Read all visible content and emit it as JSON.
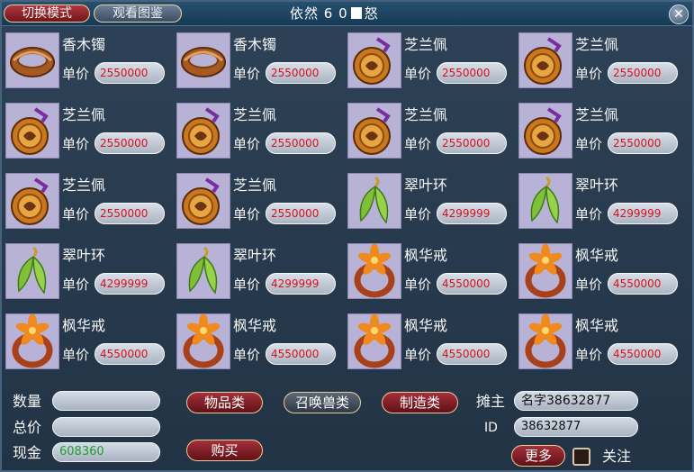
{
  "window": {
    "title": "依然 6 0",
    "title_suffix": "怒",
    "switch_mode_label": "切换模式",
    "view_atlas_label": "观看图鉴"
  },
  "price_label": "单价",
  "items": [
    {
      "name": "香木镯",
      "price": "2550000",
      "icon": "bracelet-icon"
    },
    {
      "name": "香木镯",
      "price": "2550000",
      "icon": "bracelet-icon"
    },
    {
      "name": "芝兰佩",
      "price": "2550000",
      "icon": "pendant-icon"
    },
    {
      "name": "芝兰佩",
      "price": "2550000",
      "icon": "pendant-icon"
    },
    {
      "name": "芝兰佩",
      "price": "2550000",
      "icon": "pendant-icon"
    },
    {
      "name": "芝兰佩",
      "price": "2550000",
      "icon": "pendant-icon"
    },
    {
      "name": "芝兰佩",
      "price": "2550000",
      "icon": "pendant-icon"
    },
    {
      "name": "芝兰佩",
      "price": "2550000",
      "icon": "pendant-icon"
    },
    {
      "name": "芝兰佩",
      "price": "2550000",
      "icon": "pendant-icon"
    },
    {
      "name": "芝兰佩",
      "price": "2550000",
      "icon": "pendant-icon"
    },
    {
      "name": "翠叶环",
      "price": "4299999",
      "icon": "leaf-earring-icon"
    },
    {
      "name": "翠叶环",
      "price": "4299999",
      "icon": "leaf-earring-icon"
    },
    {
      "name": "翠叶环",
      "price": "4299999",
      "icon": "leaf-earring-icon"
    },
    {
      "name": "翠叶环",
      "price": "4299999",
      "icon": "leaf-earring-icon"
    },
    {
      "name": "枫华戒",
      "price": "4550000",
      "icon": "flower-ring-icon"
    },
    {
      "name": "枫华戒",
      "price": "4550000",
      "icon": "flower-ring-icon"
    },
    {
      "name": "枫华戒",
      "price": "4550000",
      "icon": "flower-ring-icon"
    },
    {
      "name": "枫华戒",
      "price": "4550000",
      "icon": "flower-ring-icon"
    },
    {
      "name": "枫华戒",
      "price": "4550000",
      "icon": "flower-ring-icon"
    },
    {
      "name": "枫华戒",
      "price": "4550000",
      "icon": "flower-ring-icon"
    }
  ],
  "footer": {
    "quantity_label": "数量",
    "quantity_value": "",
    "total_label": "总价",
    "total_value": "",
    "cash_label": "现金",
    "cash_value": "608360",
    "tab_items": "物品类",
    "tab_pets": "召唤兽类",
    "tab_crafting": "制造类",
    "buy_label": "购买",
    "owner_label": "摊主",
    "owner_value": "名字38632877",
    "id_label": "ID",
    "id_value": "38632877",
    "more_label": "更多",
    "follow_label": "关注"
  },
  "colors": {
    "price_text": "#d8101e",
    "cash_text": "#1f9e2c",
    "item_bg": "#b8b3d6",
    "accent_red": "#8c1c24"
  }
}
